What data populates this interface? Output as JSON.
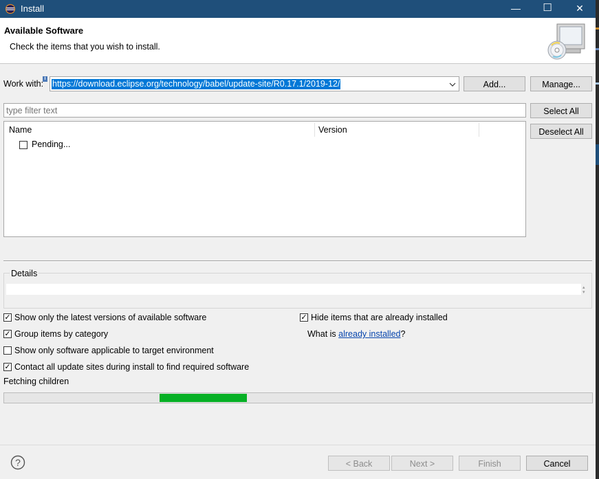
{
  "window": {
    "title": "Install",
    "app_icon": "eclipse-icon",
    "minimize": "—",
    "maximize": "☐",
    "close": "✕"
  },
  "header": {
    "title": "Available Software",
    "subtitle": "Check the items that you wish to install.",
    "banner_icon": "install-wizard-icon"
  },
  "work_with": {
    "label": "Work with:",
    "value": "https://download.eclipse.org/technology/babel/update-site/R0.17.1/2019-12/",
    "info_icon": "info-icon"
  },
  "buttons": {
    "add": "Add...",
    "manage": "Manage...",
    "select_all": "Select All",
    "deselect_all": "Deselect All"
  },
  "filter": {
    "placeholder": "type filter text"
  },
  "table": {
    "columns": [
      "Name",
      "Version"
    ],
    "rows": [
      {
        "name": "Pending...",
        "checked": false
      }
    ]
  },
  "details": {
    "label": "Details"
  },
  "options": {
    "show_latest": {
      "label": "Show only the latest versions of available software",
      "checked": true
    },
    "group_by_category": {
      "label": "Group items by category",
      "checked": true
    },
    "show_applicable": {
      "label": "Show only software applicable to target environment",
      "checked": false
    },
    "contact_sites": {
      "label": "Contact all update sites during install to find required software",
      "checked": true
    },
    "hide_installed": {
      "label": "Hide items that are already installed",
      "checked": true
    },
    "what_is_prefix": "What is ",
    "what_is_link": "already installed",
    "what_is_suffix": "?"
  },
  "status": {
    "text": "Fetching children",
    "progress_color": "#06b025"
  },
  "footer": {
    "help_icon": "help-icon",
    "back": "< Back",
    "next": "Next >",
    "finish": "Finish",
    "cancel": "Cancel"
  },
  "colors": {
    "titlebar": "#1f4f7a",
    "selection": "#0078d7",
    "dialog_bg": "#f0f0f0"
  }
}
